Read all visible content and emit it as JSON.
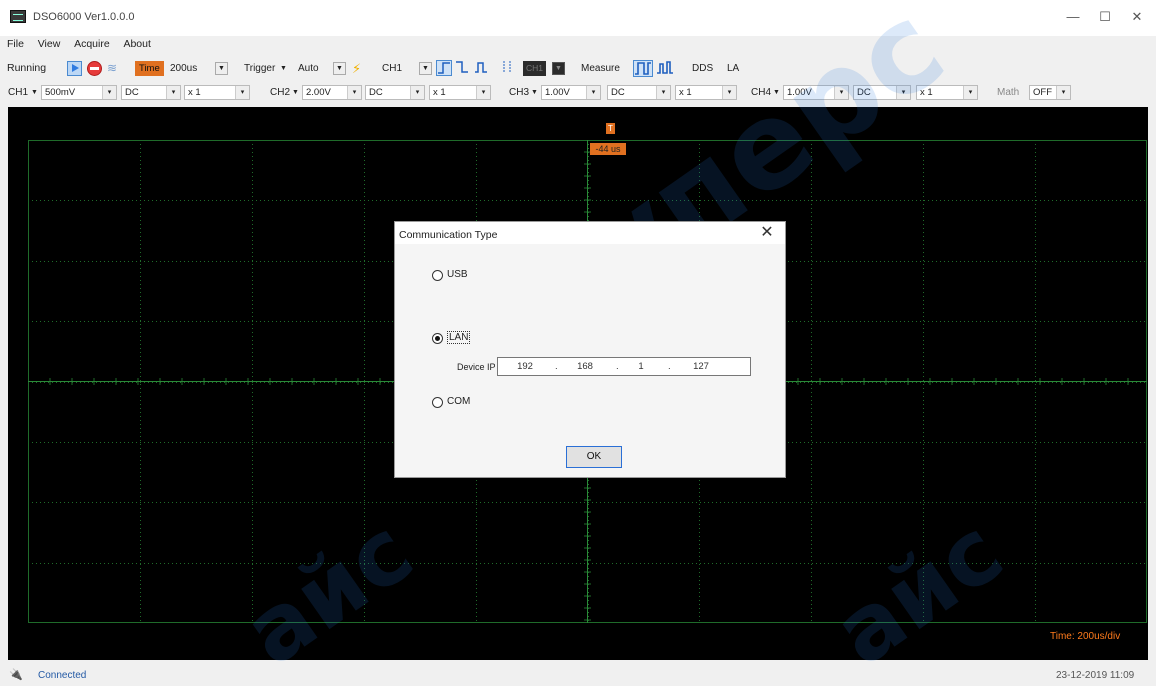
{
  "window": {
    "title": "DSO6000 Ver1.0.0.0",
    "minimize_glyph": "—",
    "maximize_glyph": "☐",
    "close_glyph": "✕"
  },
  "menu": [
    "File",
    "View",
    "Acquire",
    "About"
  ],
  "toolbar": {
    "status": "Running",
    "time_label": "Time",
    "time_value": "200us",
    "trigger_label": "Trigger",
    "trigger_mode": "Auto",
    "trigger_source": "CH1",
    "ch_badge": "CH1",
    "measure_label": "Measure",
    "dds_label": "DDS",
    "la_label": "LA"
  },
  "channels": [
    {
      "label": "CH1",
      "volts": "500mV",
      "coupling": "DC",
      "probe": "x 1"
    },
    {
      "label": "CH2",
      "volts": "2.00V",
      "coupling": "DC",
      "probe": "x 1"
    },
    {
      "label": "CH3",
      "volts": "1.00V",
      "coupling": "DC",
      "probe": "x 1"
    },
    {
      "label": "CH4",
      "volts": "1.00V",
      "coupling": "DC",
      "probe": "x 1"
    }
  ],
  "math": {
    "label": "Math",
    "value": "OFF"
  },
  "scope": {
    "trigger_marker": "T",
    "trigger_time": "-44 us",
    "time_div": "Time: 200us/div",
    "grid_color": "#1f6b2a"
  },
  "dialog": {
    "title": "Communication Type",
    "close_glyph": "✕",
    "options": {
      "usb": "USB",
      "lan": "LAN",
      "com": "COM"
    },
    "selected": "LAN",
    "ip_label": "Device IP Address",
    "ip": [
      "192",
      "168",
      "1",
      "127"
    ],
    "ok_label": "OK"
  },
  "statusbar": {
    "text": "Connected",
    "datetime": "23-12-2019 11:09"
  },
  "colors": {
    "accent_orange": "#e07020",
    "status_blue": "#245aa5",
    "scope_bg": "#000000"
  }
}
